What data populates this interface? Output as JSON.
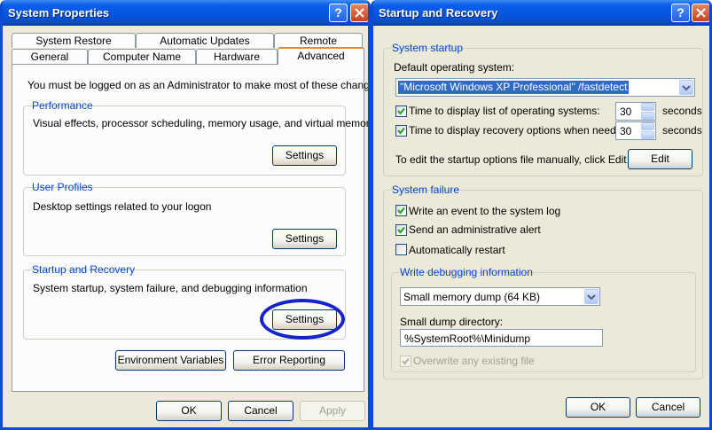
{
  "sysprops": {
    "title": "System Properties",
    "help_glyph": "?",
    "tabs_row1": [
      "System Restore",
      "Automatic Updates",
      "Remote"
    ],
    "tabs_row2": [
      "General",
      "Computer Name",
      "Hardware",
      "Advanced"
    ],
    "admin_note": "You must be logged on as an Administrator to make most of these changes.",
    "performance": {
      "title": "Performance",
      "desc": "Visual effects, processor scheduling, memory usage, and virtual memory",
      "button": "Settings"
    },
    "user_profiles": {
      "title": "User Profiles",
      "desc": "Desktop settings related to your logon",
      "button": "Settings"
    },
    "startup_recovery": {
      "title": "Startup and Recovery",
      "desc": "System startup, system failure, and debugging information",
      "button": "Settings"
    },
    "env_button": "Environment Variables",
    "error_button": "Error Reporting",
    "ok": "OK",
    "cancel": "Cancel",
    "apply": "Apply"
  },
  "startup": {
    "title": "Startup and Recovery",
    "help_glyph": "?",
    "system_startup": {
      "title": "System startup",
      "default_os_label": "Default operating system:",
      "default_os_value": "\"Microsoft Windows XP Professional\" /fastdetect",
      "time_list_label": "Time to display list of operating systems:",
      "time_list_value": "30",
      "time_list_checked": true,
      "time_recovery_label": "Time to display recovery options when needed:",
      "time_recovery_value": "30",
      "time_recovery_checked": true,
      "seconds": "seconds",
      "edit_note": "To edit the startup options file manually, click Edit.",
      "edit_button": "Edit"
    },
    "system_failure": {
      "title": "System failure",
      "write_event": "Write an event to the system log",
      "write_event_checked": true,
      "send_alert": "Send an administrative alert",
      "send_alert_checked": true,
      "auto_restart": "Automatically restart",
      "auto_restart_checked": false
    },
    "debug": {
      "title": "Write debugging information",
      "dump_type": "Small memory dump (64 KB)",
      "dir_label": "Small dump directory:",
      "dir_value": "%SystemRoot%\\Minidump",
      "overwrite": "Overwrite any existing file",
      "overwrite_checked": true,
      "overwrite_enabled": false
    },
    "ok": "OK",
    "cancel": "Cancel"
  },
  "colors": {
    "titlebar": "#0a5ee8",
    "group_title": "#0046d5",
    "highlight": "#316ac5",
    "annotation_ellipse": "#1424c8"
  }
}
